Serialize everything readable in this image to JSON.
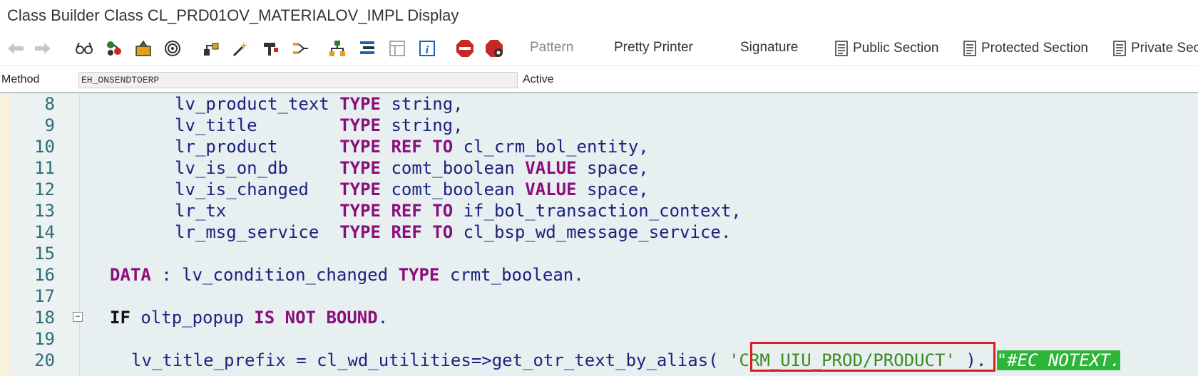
{
  "window": {
    "title": "Class Builder Class CL_PRD01OV_MATERIALOV_IMPL Display"
  },
  "toolbar": {
    "icons": [
      "back-arrow-icon",
      "forward-arrow-icon",
      "glasses-icon",
      "object-list-icon",
      "other-object-icon",
      "display-object-list-icon",
      "where-used-icon",
      "hierarchy-icon",
      "activate-wand-icon",
      "test-icon",
      "navigator-icon",
      "class-hierarchy-icon",
      "layout-icon",
      "properties-icon",
      "info-icon",
      "stop-icon",
      "stop-breakpoint-icon"
    ],
    "pattern_label": "Pattern",
    "pretty_printer_label": "Pretty Printer",
    "signature_label": "Signature",
    "public_section_label": "Public Section",
    "protected_section_label": "Protected Section",
    "private_section_label": "Private Sec"
  },
  "method_bar": {
    "label": "Method",
    "value": "EH_ONSENDTOERP",
    "status": "Active"
  },
  "editor": {
    "line_numbers": [
      "8",
      "9",
      "10",
      "11",
      "12",
      "13",
      "14",
      "15",
      "16",
      "17",
      "18",
      "19",
      "20"
    ],
    "lines": [
      {
        "indent": "        ",
        "var": "lv_product_text",
        "pad": " ",
        "kw": "TYPE",
        "rest": " string,"
      },
      {
        "indent": "        ",
        "var": "lv_title",
        "pad": "        ",
        "kw": "TYPE",
        "rest": " string,"
      },
      {
        "indent": "        ",
        "var": "lr_product",
        "pad": "      ",
        "kw": "TYPE REF TO",
        "rest": " cl_crm_bol_entity,"
      },
      {
        "indent": "        ",
        "var": "lv_is_on_db",
        "pad": "     ",
        "kw": "TYPE",
        "rest": " comt_boolean ",
        "kw2": "VALUE",
        "rest2": " space,"
      },
      {
        "indent": "        ",
        "var": "lv_is_changed",
        "pad": "   ",
        "kw": "TYPE",
        "rest": " comt_boolean ",
        "kw2": "VALUE",
        "rest2": " space,"
      },
      {
        "indent": "        ",
        "var": "lr_tx",
        "pad": "           ",
        "kw": "TYPE REF TO",
        "rest": " if_bol_transaction_context,"
      },
      {
        "indent": "        ",
        "var": "lr_msg_service",
        "pad": "  ",
        "kw": "TYPE REF TO",
        "rest": " cl_bsp_wd_message_service."
      }
    ],
    "data_line": {
      "kw": "DATA",
      "mid": " : lv_condition_changed ",
      "kw2": "TYPE",
      "rest": " crmt_boolean."
    },
    "if_line": {
      "kw": "IF",
      "mid": " oltp_popup ",
      "kw2": "IS NOT BOUND",
      "rest": "."
    },
    "call_line": {
      "start": "lv_title_prefix = cl_wd_utilities=>get_otr_text_by_alias( ",
      "string": "'CRM_UIU_PROD/PRODUCT'",
      "end": " ). ",
      "comment": "\"#EC NOTEXT."
    },
    "colors": {
      "keyword": "#8b0e7a",
      "identifier": "#1a237e",
      "string": "#3a8a1e",
      "comment_bg": "#2db53a",
      "highlight_box": "#d71e1e",
      "line_number": "#2d6e78",
      "editor_bg": "#e8eff1"
    }
  }
}
